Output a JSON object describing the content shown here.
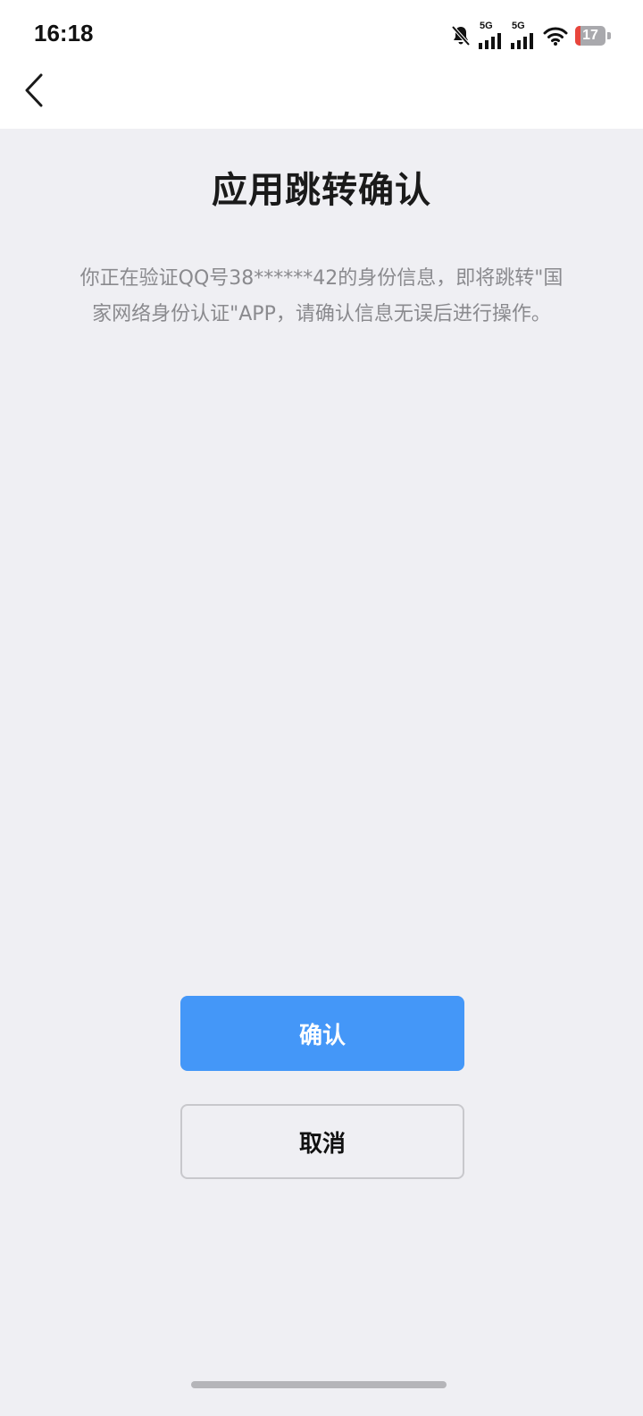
{
  "status_bar": {
    "time": "16:18",
    "signal_1_label": "5G",
    "signal_2_label": "5G",
    "battery_level": "17",
    "icons": [
      "bell-off-icon",
      "signal-icon",
      "signal-icon",
      "wifi-icon",
      "battery-icon"
    ]
  },
  "nav": {
    "back_icon": "chevron-left-icon"
  },
  "page": {
    "title": "应用跳转确认",
    "description": "你正在验证QQ号38******42的身份信息，即将跳转\"国家网络身份认证\"APP，请确认信息无误后进行操作。"
  },
  "actions": {
    "confirm_label": "确认",
    "cancel_label": "取消"
  },
  "colors": {
    "background": "#efeff3",
    "primary": "#4497f8",
    "battery_low": "#e8453c"
  }
}
